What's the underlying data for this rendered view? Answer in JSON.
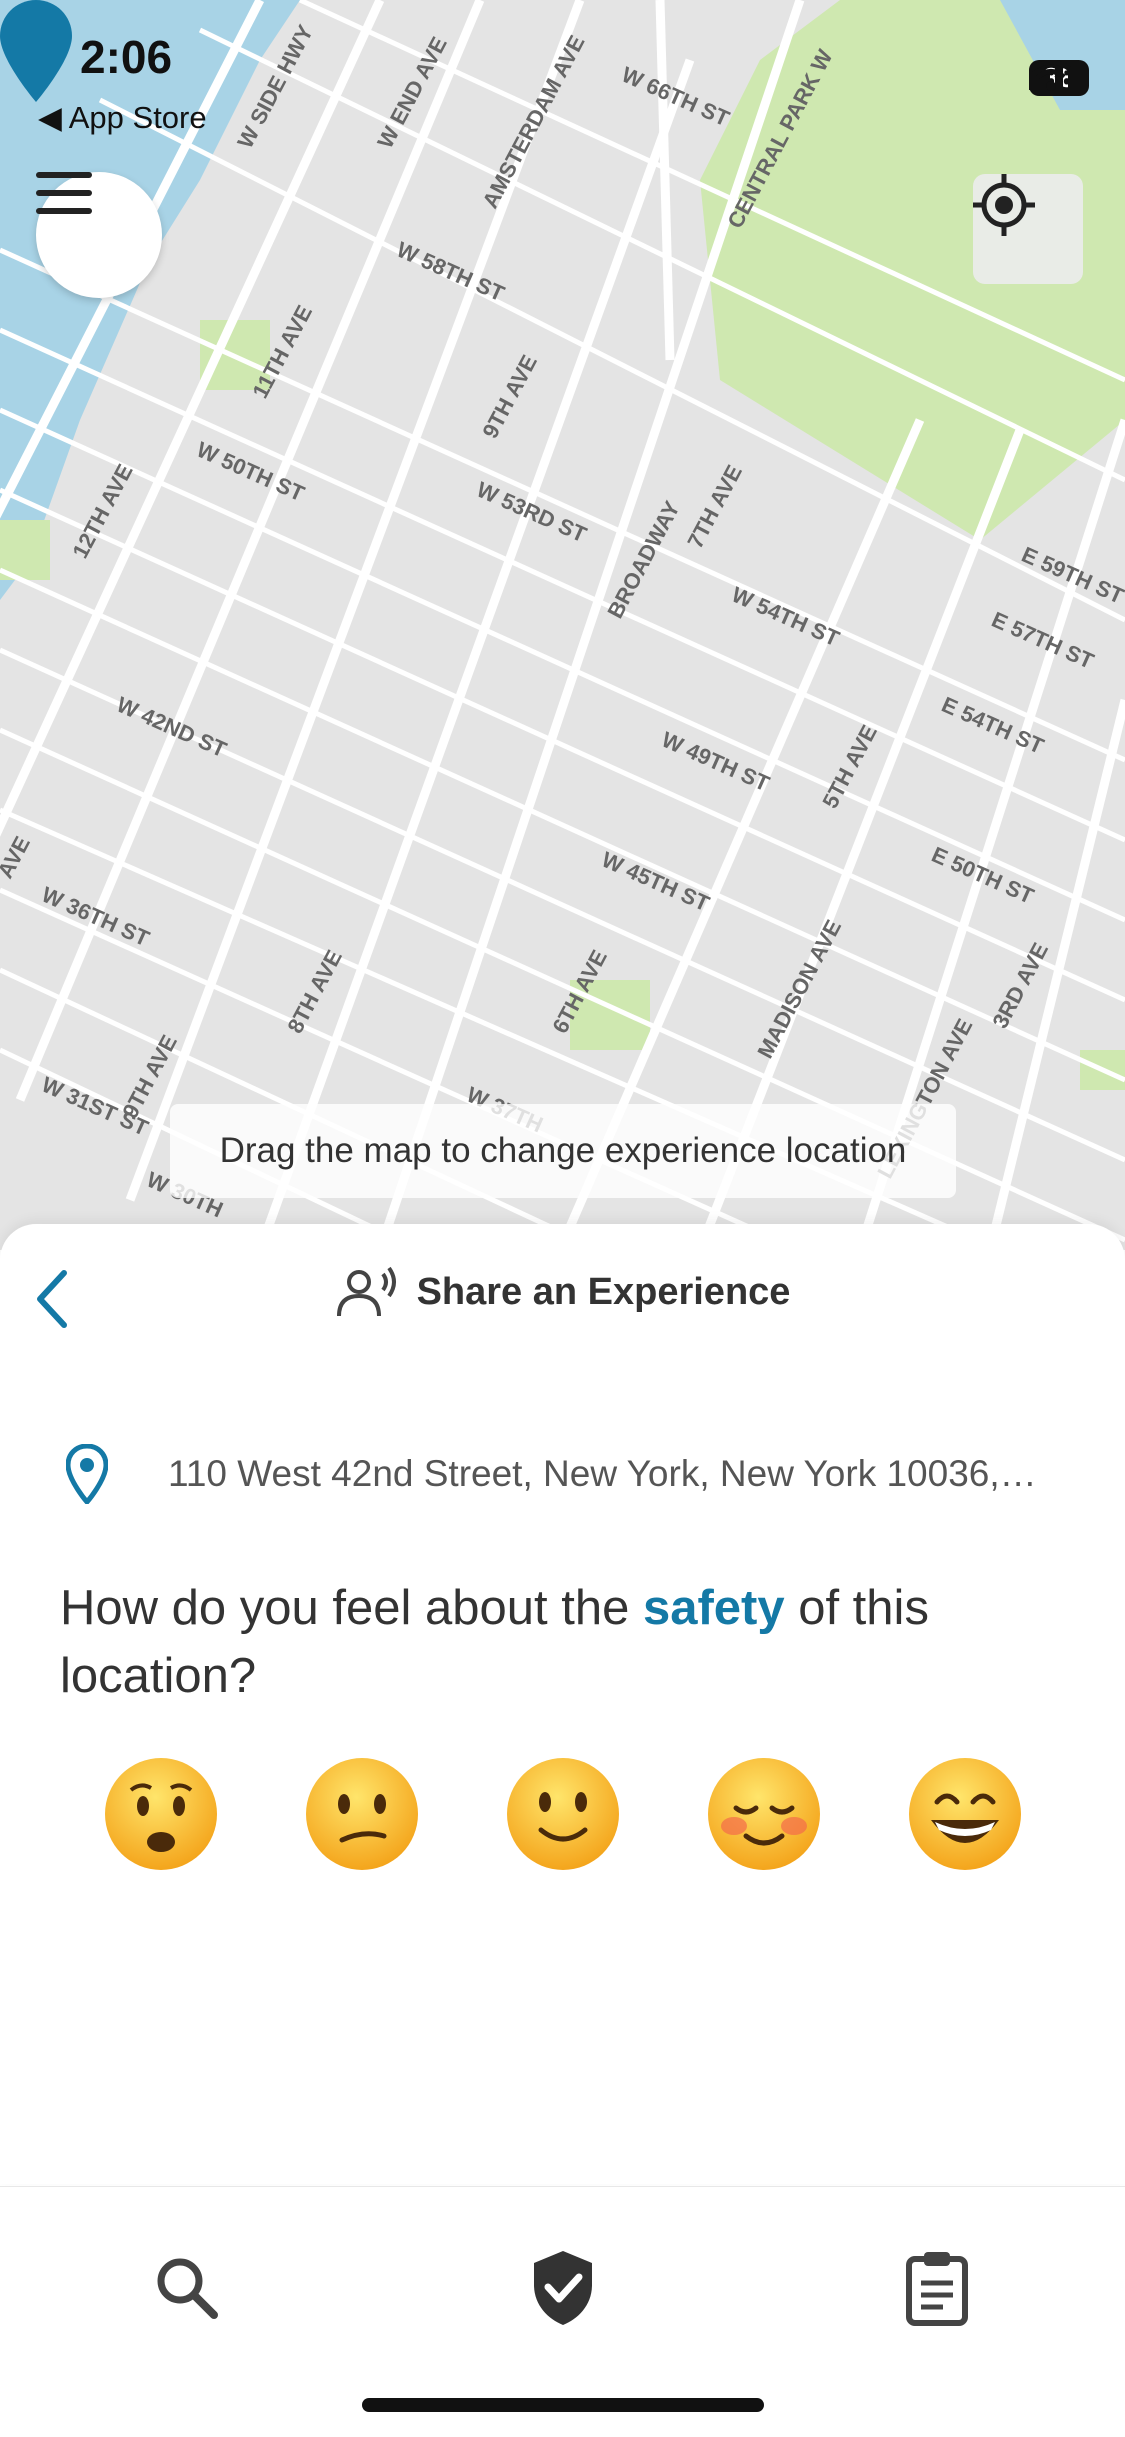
{
  "status_bar": {
    "time": "2:06",
    "back_label": "App Store",
    "battery": "88"
  },
  "map": {
    "hint": "Drag the map to change experience location",
    "labels": [
      "W SIDE HWY",
      "W END AVE",
      "AMSTERDAM AVE",
      "W 66TH ST",
      "CENTRAL PARK W",
      "W 58TH ST",
      "11TH AVE",
      "9TH AVE",
      "W 50TH ST",
      "12TH AVE",
      "W 53RD ST",
      "BROADWAY",
      "7TH AVE",
      "W 54TH ST",
      "E 59TH ST",
      "E 57TH ST",
      "W 42ND ST",
      "W 49TH ST",
      "5TH AVE",
      "E 54TH ST",
      "W 45TH ST",
      "E 50TH ST",
      "W 36TH ST",
      "8TH AVE",
      "6TH AVE",
      "MADISON AVE",
      "3RD AVE",
      "9TH AVE",
      "W 31ST ST",
      "W 37TH",
      "W 30TH",
      "LEXINGTON AVE",
      "AVE"
    ]
  },
  "sheet": {
    "title": "Share an Experience",
    "address": "110 West 42nd Street, New York, New York 10036,…",
    "question_prefix": "How do you feel about the ",
    "question_highlight": "safety",
    "question_suffix": " of this location?"
  },
  "emojis": [
    {
      "name": "anguished-face",
      "glyph": "😧"
    },
    {
      "name": "confused-face",
      "glyph": "😕"
    },
    {
      "name": "slightly-smiling-face",
      "glyph": "🙂"
    },
    {
      "name": "smiling-face-blush",
      "glyph": "☺️"
    },
    {
      "name": "beaming-grin-face",
      "glyph": "😁"
    }
  ],
  "colors": {
    "accent": "#1479a6",
    "map_bg": "#e6e6e6",
    "water": "#a8d3e6",
    "park": "#cfe8b0"
  },
  "icons": {
    "menu": "hamburger-icon",
    "locate": "crosshair-icon",
    "back": "chevron-left-icon",
    "speaker": "person-speaking-icon",
    "pin": "location-pin-icon",
    "search_tab": "search-icon",
    "share_tab": "shield-check-icon",
    "list_tab": "clipboard-icon"
  }
}
